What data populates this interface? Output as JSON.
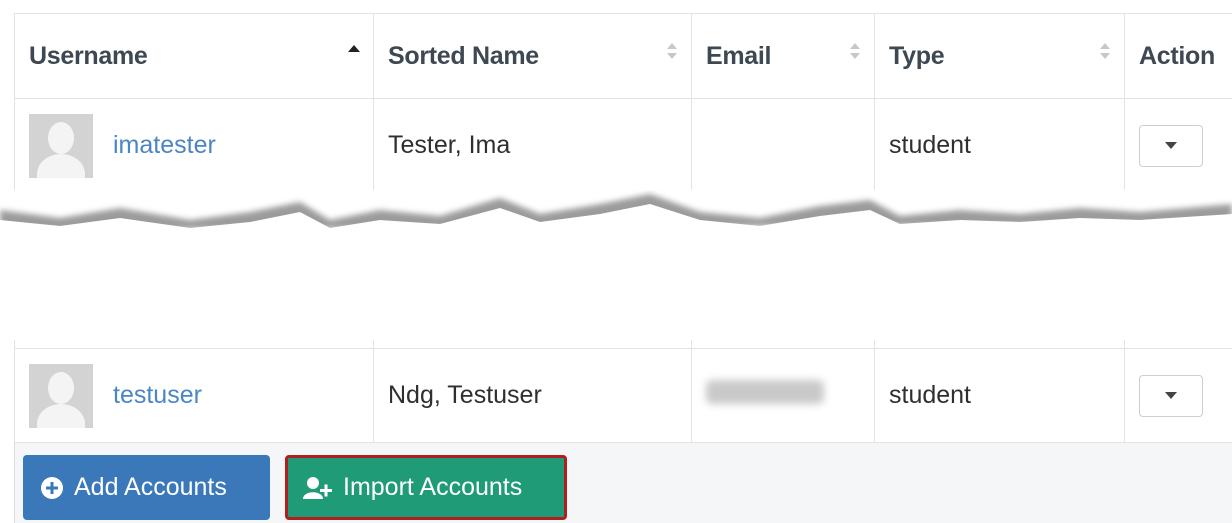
{
  "table": {
    "headers": {
      "username": "Username",
      "sorted_name": "Sorted Name",
      "email": "Email",
      "type": "Type",
      "action": "Action"
    },
    "rows": [
      {
        "username": "imatester",
        "sorted_name": "Tester, Ima",
        "email": "",
        "type": "student"
      },
      {
        "username": "testuser",
        "sorted_name": "Ndg, Testuser",
        "email": "[blurred]",
        "type": "student"
      }
    ]
  },
  "buttons": {
    "add_accounts": "Add Accounts",
    "import_accounts": "Import Accounts"
  },
  "colors": {
    "link": "#4a86c5",
    "add_button": "#3a78ba",
    "import_button": "#1f9b78",
    "highlight_border": "#b01e1e"
  },
  "icons": {
    "avatar": "default-avatar-icon",
    "sort_asc": "sort-ascending-icon",
    "sortable": "sortable-icon",
    "dropdown": "caret-down-icon",
    "add": "plus-circle-icon",
    "import": "user-plus-icon"
  }
}
